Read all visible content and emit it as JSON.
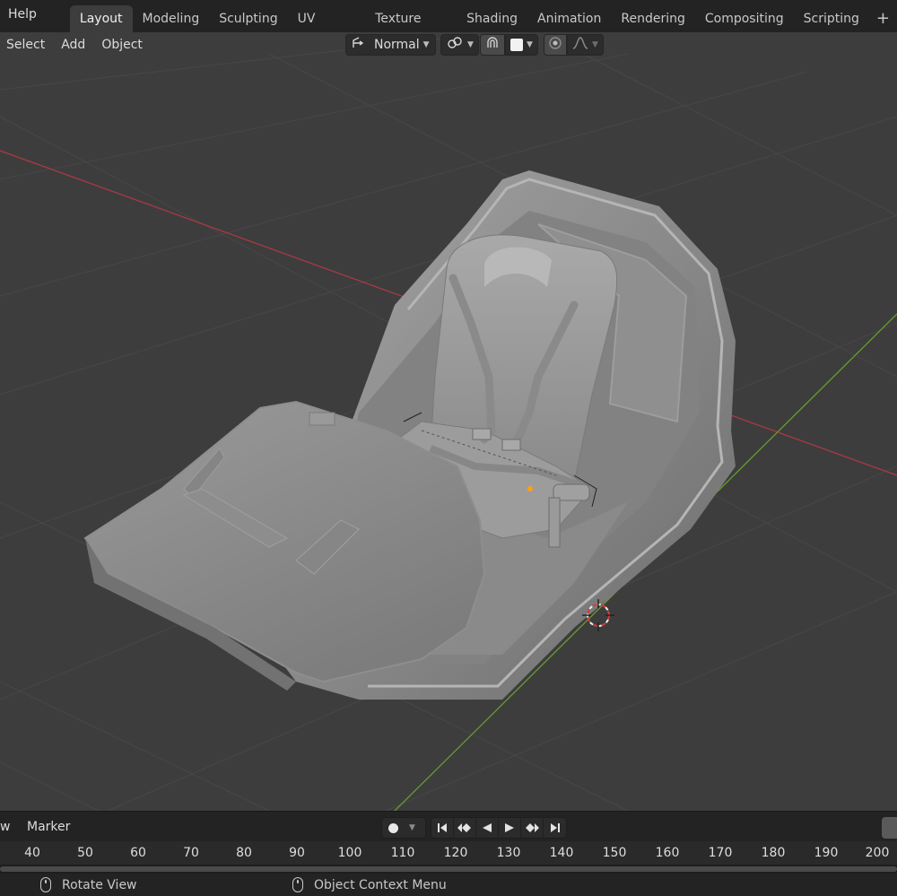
{
  "topbar": {
    "help_label": "Help",
    "tabs": [
      {
        "label": "Layout",
        "active": true
      },
      {
        "label": "Modeling",
        "active": false
      },
      {
        "label": "Sculpting",
        "active": false
      },
      {
        "label": "UV Editing",
        "active": false
      },
      {
        "label": "Texture Paint",
        "active": false
      },
      {
        "label": "Shading",
        "active": false
      },
      {
        "label": "Animation",
        "active": false
      },
      {
        "label": "Rendering",
        "active": false
      },
      {
        "label": "Compositing",
        "active": false
      },
      {
        "label": "Scripting",
        "active": false
      }
    ],
    "add_tab_label": "+"
  },
  "viewport_header": {
    "menus": [
      "Select",
      "Add",
      "Object"
    ],
    "transform_orientation": "Normal",
    "icons": [
      "orientation-icon",
      "pivot-link-icon",
      "snap-magnet-icon",
      "snap-target-square-icon",
      "proportional-edit-icon",
      "falloff-curve-icon"
    ]
  },
  "viewport": {
    "object_description_icon": "kart-seat-3d-model",
    "accent": {
      "x_axis": "#a83a44",
      "y_axis": "#6b9a2e",
      "cursor": "#d83a3a",
      "origin": "#ff9f1a"
    }
  },
  "timeline": {
    "menus": [
      "w",
      "Marker"
    ],
    "playback_icons": [
      "jump-start-icon",
      "prev-keyframe-icon",
      "play-reverse-icon",
      "play-icon",
      "next-keyframe-icon",
      "jump-end-icon"
    ],
    "ticks": [
      "40",
      "50",
      "60",
      "70",
      "80",
      "90",
      "100",
      "110",
      "120",
      "130",
      "140",
      "150",
      "160",
      "170",
      "180",
      "190",
      "200"
    ]
  },
  "statusbar": {
    "items": [
      {
        "icon": "mouse-middle-icon",
        "label": "Rotate View"
      },
      {
        "icon": "mouse-right-icon",
        "label": "Object Context Menu"
      }
    ]
  }
}
